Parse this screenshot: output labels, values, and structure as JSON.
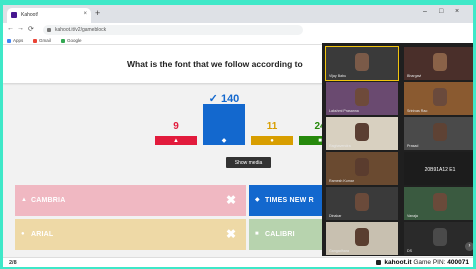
{
  "browser": {
    "tab_title": "Kahoot!",
    "tab_close": "×",
    "new_tab": "+",
    "window_controls": [
      "–",
      "□",
      "×"
    ],
    "nav_buttons": [
      "←",
      "→",
      "⟳"
    ],
    "url": "kahoot.it/v2/gameblock",
    "bookmarks": [
      {
        "label": "Apps",
        "color": "#4285f4"
      },
      {
        "label": "Gmail",
        "color": "#ea4335"
      },
      {
        "label": "Google",
        "color": "#34a853"
      }
    ]
  },
  "question": {
    "text": "What is the font that we follow according to"
  },
  "results": {
    "bars": [
      {
        "count": "9",
        "value": 9,
        "color": "#e21b3c",
        "shape": "▲"
      },
      {
        "count": "✓ 140",
        "value": 140,
        "color": "#1368ce",
        "shape": "◆"
      },
      {
        "count": "11",
        "value": 11,
        "color": "#d89e00",
        "shape": "●"
      },
      {
        "count": "24",
        "value": 24,
        "color": "#26890c",
        "shape": "■"
      }
    ],
    "show_media": "Show media"
  },
  "answers": [
    {
      "label": "CAMBRIA",
      "shape": "▲",
      "color": "#f0b8c2",
      "mark": "✖"
    },
    {
      "label": "TIMES NEW R",
      "shape": "◆",
      "color": "#1368ce",
      "mark": ""
    },
    {
      "label": "ARIAL",
      "shape": "●",
      "color": "#eed9a6",
      "mark": "✖"
    },
    {
      "label": "CALIBRI",
      "shape": "■",
      "color": "#b7d3ae",
      "mark": ""
    }
  ],
  "footer": {
    "progress": "2/8",
    "brand": "kahoot.it",
    "pin_label": "Game PIN:",
    "pin": "400071"
  },
  "video_panel": {
    "tiles": [
      {
        "name": "Vijay Babu",
        "face": "#7a5a48",
        "bg": "#3a3a3a",
        "label": ""
      },
      {
        "name": "Bhargavi",
        "face": "#8a6248",
        "bg": "#4a2f2a",
        "label": ""
      },
      {
        "name": "Lakshmi Prasanna",
        "face": "#6e4a3a",
        "bg": "#6a4a70",
        "label": ""
      },
      {
        "name": "Srinivas Rao",
        "face": "#6a4a3c",
        "bg": "#8a5a30",
        "label": ""
      },
      {
        "name": "Raghavendra",
        "face": "#5a3e32",
        "bg": "#d8d0c0",
        "label": ""
      },
      {
        "name": "Prasad",
        "face": "#5e4234",
        "bg": "#4a4a4a",
        "label": ""
      },
      {
        "name": "Ramesh Kumar",
        "face": "#5a3c2e",
        "bg": "#6a4a30",
        "label": ""
      },
      {
        "name": "",
        "face": "",
        "bg": "#1c1c1c",
        "label": "20B91A12 E1"
      },
      {
        "name": "Dinakar",
        "face": "#6a4a3a",
        "bg": "#3a3a3a",
        "label": ""
      },
      {
        "name": "Vanaja",
        "face": "#6a4a3a",
        "bg": "#3a5a40",
        "label": ""
      },
      {
        "name": "Gangadhara",
        "face": "#5a3e30",
        "bg": "#c8c0b0",
        "label": ""
      },
      {
        "name": "DS",
        "face": "#4a4a4a",
        "bg": "#2a2a2a",
        "label": ""
      }
    ],
    "next_label": "›"
  }
}
